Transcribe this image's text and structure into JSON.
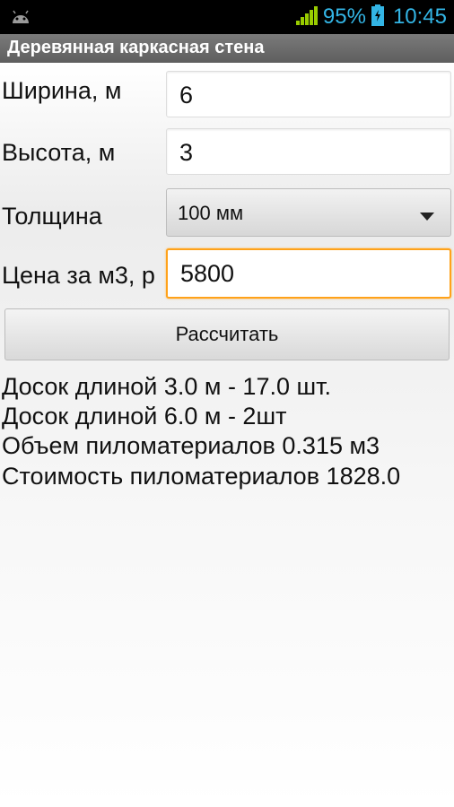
{
  "status_bar": {
    "battery_percent": "95%",
    "time": "10:45",
    "icons": [
      "android-icon",
      "signal-icon",
      "battery-icon"
    ]
  },
  "app": {
    "title": "Деревянная каркасная стена"
  },
  "form": {
    "width": {
      "label": "Ширина, м",
      "value": "6"
    },
    "height": {
      "label": "Высота, м",
      "value": "3"
    },
    "thickness": {
      "label": "Толщина",
      "selected": "100 мм"
    },
    "price": {
      "label": "Цена за м3, р",
      "value": "5800"
    },
    "calculate_label": "Рассчитать"
  },
  "results": [
    "Досок длиной 3.0 м - 17.0 шт.",
    "Досок длиной 6.0 м - 2шт",
    "Объем пиломатериалов 0.315 м3",
    "Стоимость пиломатериалов 1828.0"
  ],
  "colors": {
    "accent": "#33b5e5",
    "focus": "#ffa21a",
    "signal": "#99cc00"
  }
}
